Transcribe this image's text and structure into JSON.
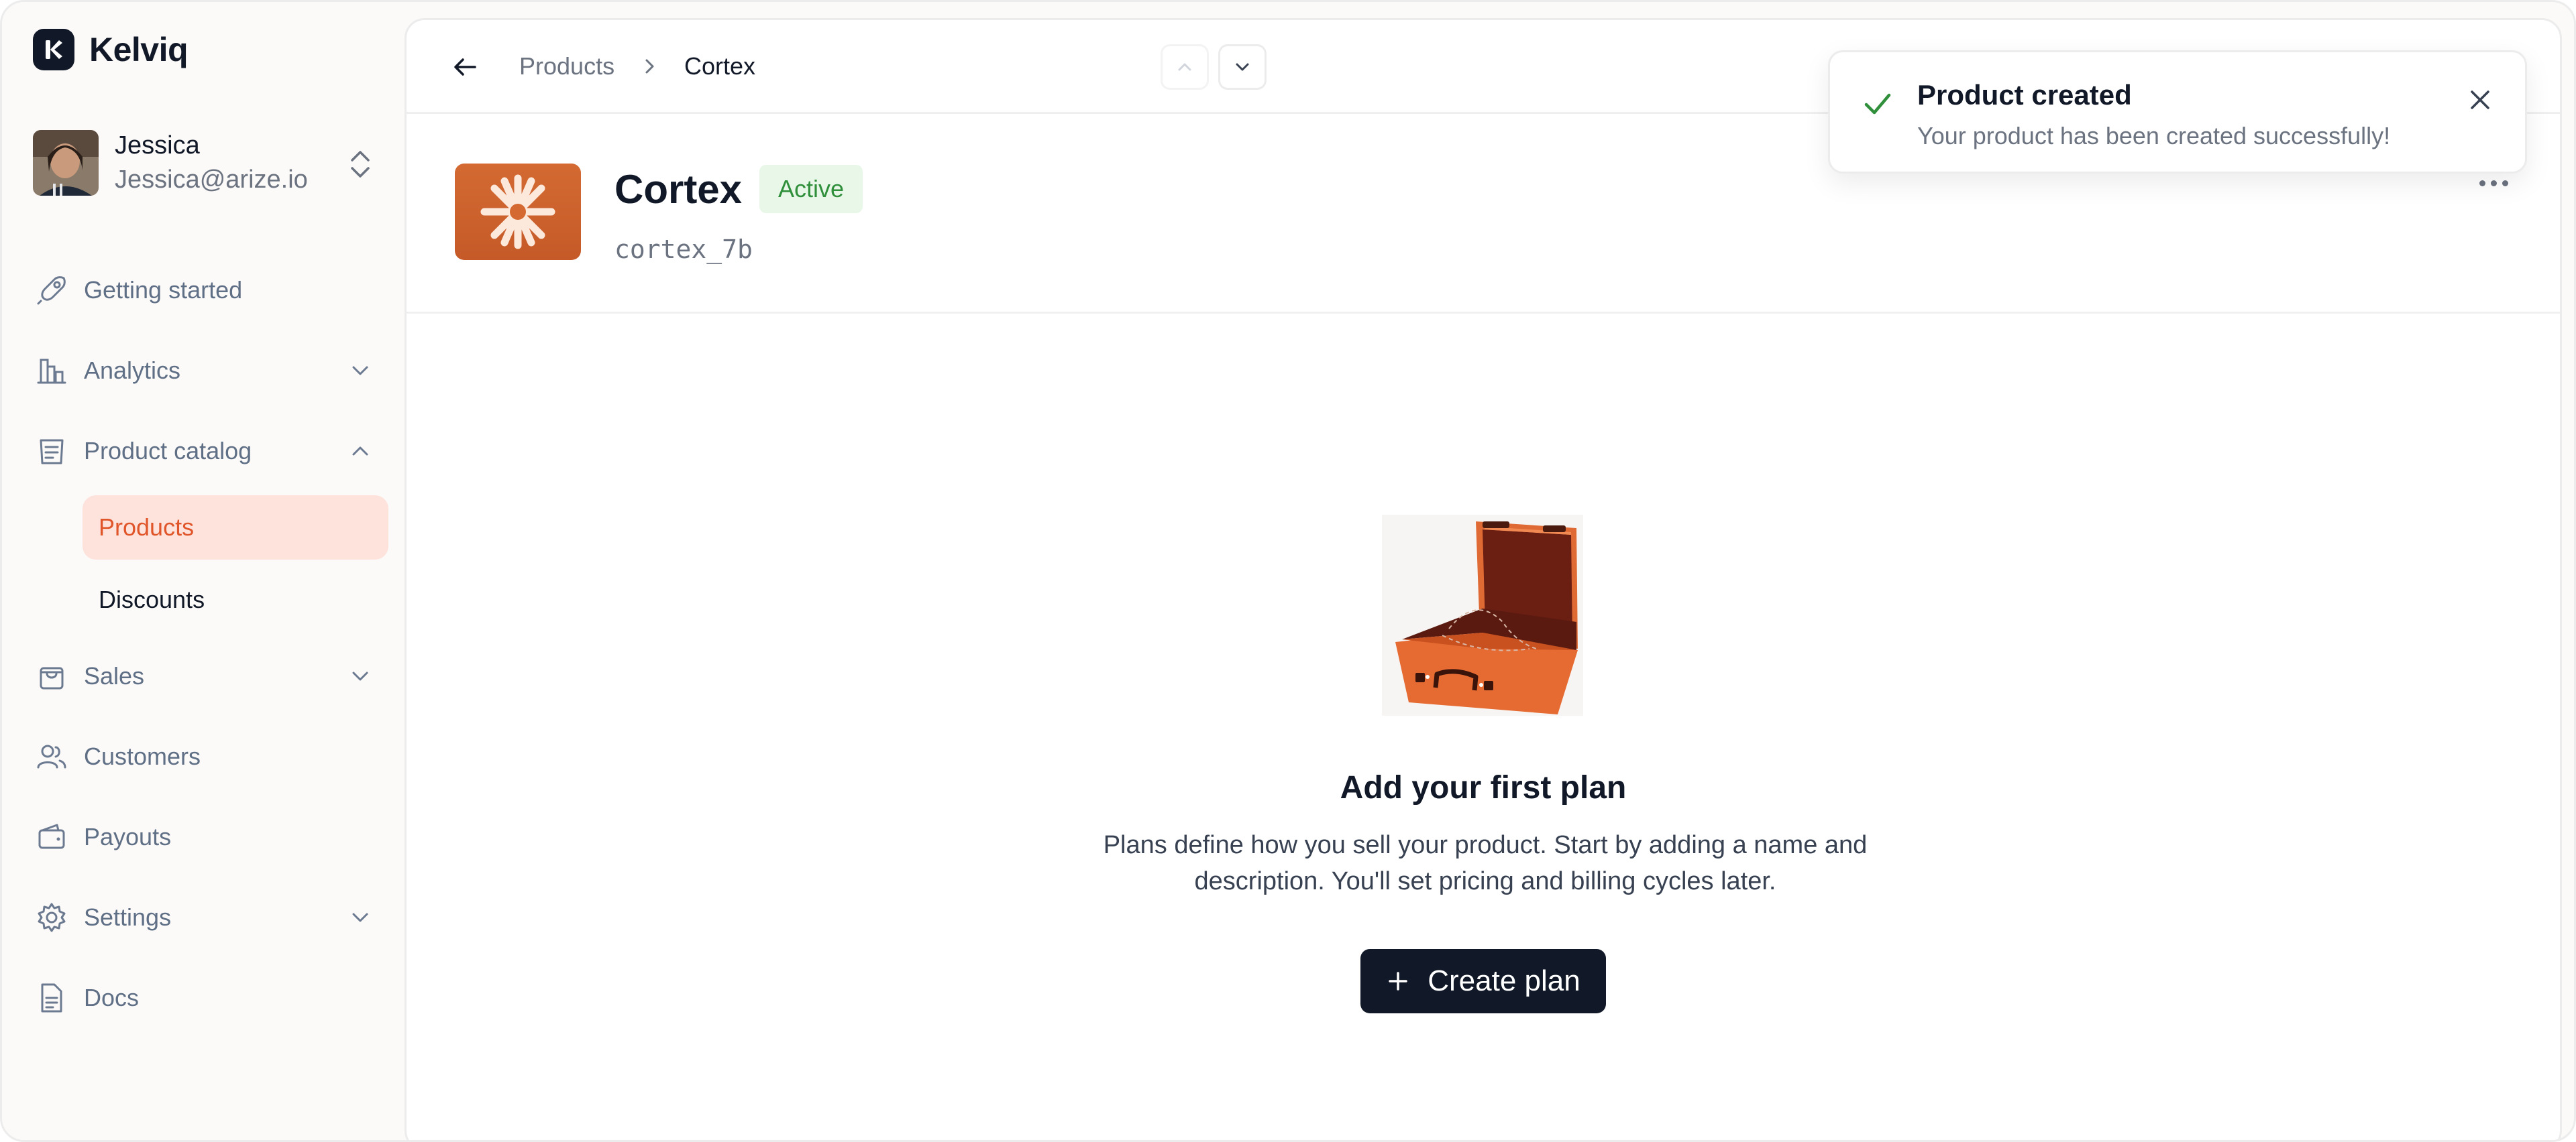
{
  "brand": {
    "name": "Kelviq",
    "accent": "#e0552a"
  },
  "user": {
    "name": "Jessica",
    "email": "Jessica@arize.io"
  },
  "nav": {
    "getting_started": "Getting started",
    "analytics": "Analytics",
    "product_catalog": "Product catalog",
    "products": "Products",
    "discounts": "Discounts",
    "sales": "Sales",
    "customers": "Customers",
    "payouts": "Payouts",
    "settings": "Settings",
    "docs": "Docs"
  },
  "breadcrumb": {
    "parent": "Products",
    "current": "Cortex"
  },
  "product": {
    "name": "Cortex",
    "status": "Active",
    "id": "cortex_7b"
  },
  "empty_state": {
    "title": "Add your first plan",
    "description": "Plans define how you sell your product. Start by adding a name and description. You'll set pricing and billing cycles later.",
    "button": "Create plan"
  },
  "toast": {
    "title": "Product created",
    "message": "Your product has been created successfully!",
    "status_color": "#2f8f3a"
  }
}
